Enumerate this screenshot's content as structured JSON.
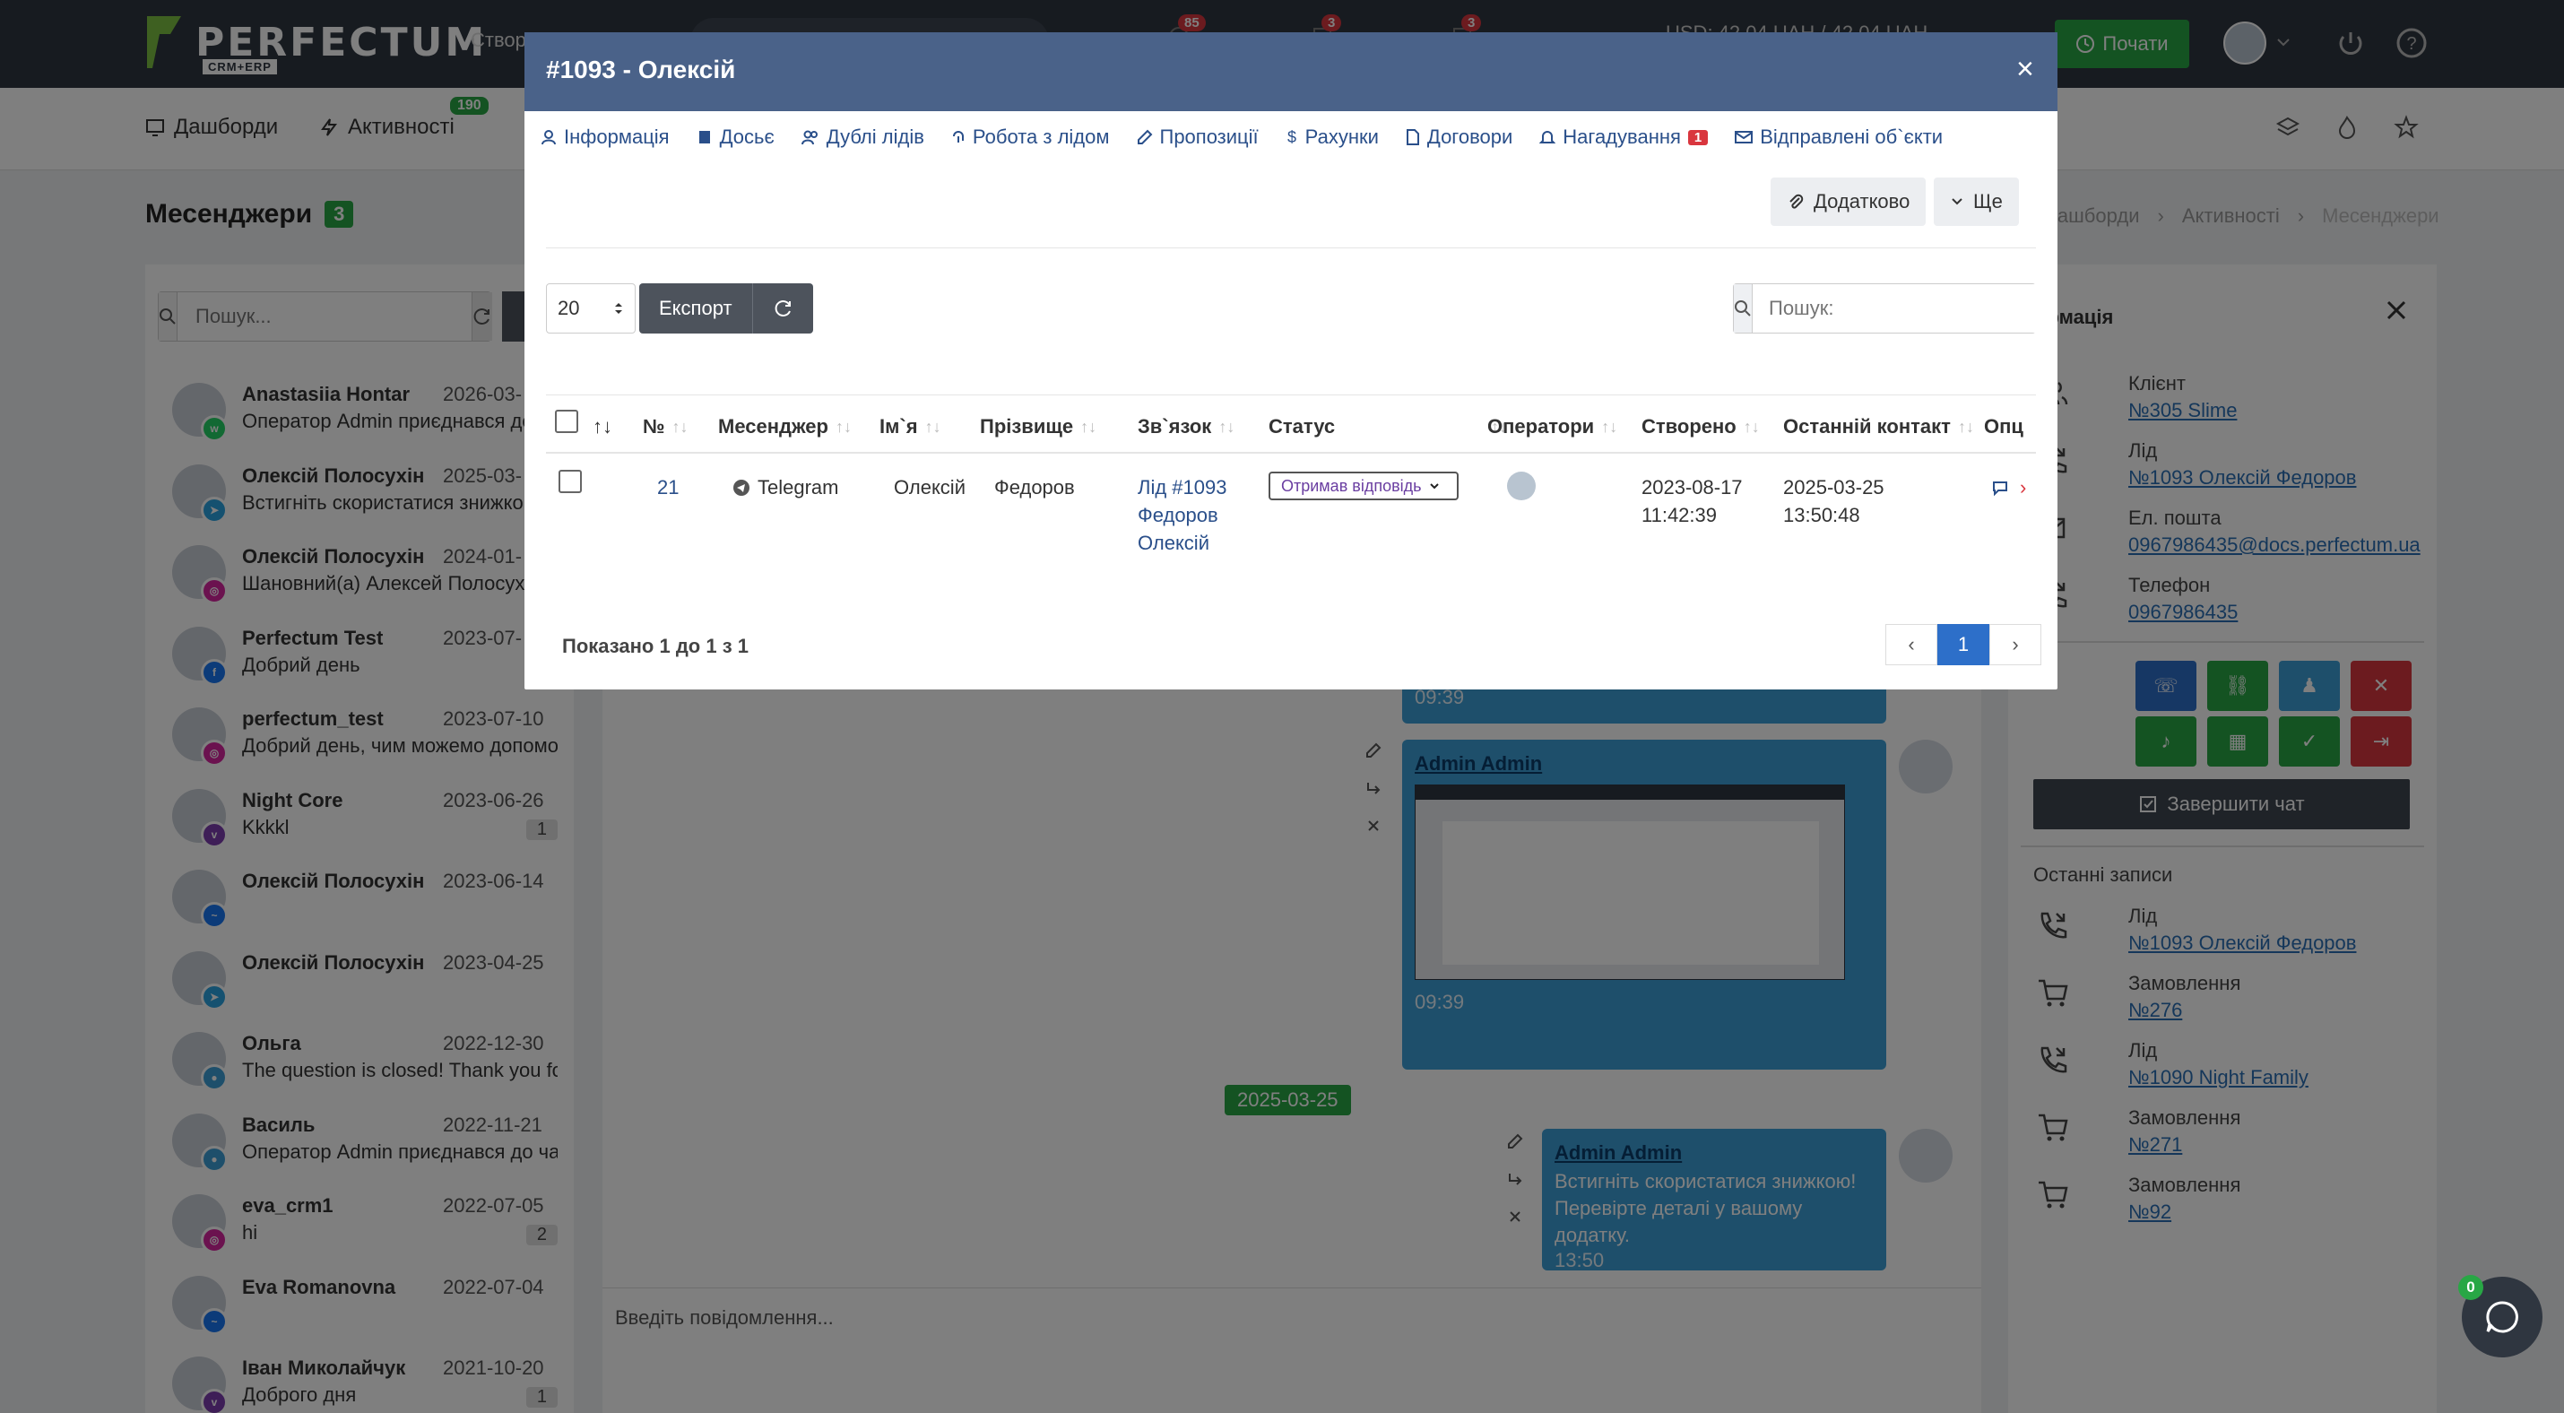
{
  "brand": {
    "name": "PERFECTUM",
    "sub": "CRM+ERP"
  },
  "topbar": {
    "create_label": "Створ",
    "badges": [
      "85",
      "3",
      "3"
    ],
    "rates": "USD: 42.04 UAH / 42.04 UAH",
    "start_button": "Почати"
  },
  "subnav": {
    "items": [
      {
        "label": "Дашборди",
        "icon": "dashboard-icon"
      },
      {
        "label": "Активності",
        "icon": "bolt-icon",
        "badge": "190"
      }
    ]
  },
  "page": {
    "title": "Месенджери",
    "count": "3"
  },
  "breadcrumbs": [
    "Дашборди",
    "Активності",
    "Месенджери"
  ],
  "chatlist": {
    "search_placeholder": "Пошук...",
    "chats": [
      {
        "name": "Anastasiia Hontar",
        "date": "2026-03-",
        "msg": "Оператор Admin приєднався до",
        "net": "whatsapp",
        "count": ""
      },
      {
        "name": "Олексій Полосухін",
        "date": "2025-03-",
        "msg": "Встигніть скористатися знижкою",
        "net": "telegram",
        "count": ""
      },
      {
        "name": "Олексій Полосухін",
        "date": "2024-01-",
        "msg": "Шановний(а) Алексей Полосухин",
        "net": "instagram",
        "count": ""
      },
      {
        "name": "Perfectum Test",
        "date": "2023-07-",
        "msg": "Добрий день",
        "net": "facebook",
        "count": ""
      },
      {
        "name": "perfectum_test",
        "date": "2023-07-10",
        "msg": "Добрий день, чим можемо допомо",
        "net": "instagram",
        "count": ""
      },
      {
        "name": "Night Core",
        "date": "2023-06-26",
        "msg": "Kkkkl",
        "net": "viber",
        "count": "1"
      },
      {
        "name": "Олексій Полосухін",
        "date": "2023-06-14",
        "msg": "",
        "net": "messenger",
        "count": ""
      },
      {
        "name": "Олексій Полосухін",
        "date": "2023-04-25",
        "msg": "",
        "net": "telegram",
        "count": ""
      },
      {
        "name": "Ольга",
        "date": "2022-12-30",
        "msg": "The question is closed! Thank you fo",
        "net": "webchat",
        "count": ""
      },
      {
        "name": "Василь",
        "date": "2022-11-21",
        "msg": "Оператор Admin приєднався до чат",
        "net": "webchat",
        "count": ""
      },
      {
        "name": "eva_crm1",
        "date": "2022-07-05",
        "msg": "hi",
        "net": "instagram",
        "count": "2"
      },
      {
        "name": "Eva Romanovna",
        "date": "2022-07-04",
        "msg": "",
        "net": "messenger",
        "count": ""
      },
      {
        "name": "Іван Миколайчук",
        "date": "2021-10-20",
        "msg": "Доброго дня",
        "net": "viber",
        "count": "1"
      }
    ]
  },
  "chat": {
    "messages": [
      {
        "author": "",
        "text": "",
        "time": "09:39"
      },
      {
        "author": "Admin Admin",
        "text": "",
        "time": "09:39"
      },
      {
        "author": "Admin Admin",
        "text": "Встигніть скористатися знижкою! Перевірте деталі у вашому додатку.",
        "time": "13:50"
      }
    ],
    "date_separator": "2025-03-25",
    "composer_placeholder": "Введіть повідомлення..."
  },
  "info": {
    "header": "ормація",
    "rows": [
      {
        "label": "Клієнт",
        "value": "№305 Slime",
        "icon": "clients-icon"
      },
      {
        "label": "Лід",
        "value": "№1093 Олексій Федоров",
        "icon": "lead-phone-icon"
      },
      {
        "label": "Ел. пошта",
        "value": "0967986435@docs.perfectum.ua",
        "icon": "mail-icon"
      },
      {
        "label": "Телефон",
        "value": "0967986435",
        "icon": "phone-icon"
      }
    ],
    "finish_button": "Завершити чат",
    "recent_title": "Останні записи",
    "recent": [
      {
        "label": "Лід",
        "value": "№1093 Олексій Федоров",
        "icon": "lead-phone-icon"
      },
      {
        "label": "Замовлення",
        "value": "№276",
        "icon": "cart-icon"
      },
      {
        "label": "Лід",
        "value": "№1090 Night Family",
        "icon": "lead-phone-icon"
      },
      {
        "label": "Замовлення",
        "value": "№271",
        "icon": "cart-icon"
      },
      {
        "label": "Замовлення",
        "value": "№92",
        "icon": "cart-icon"
      }
    ],
    "action_colors": [
      "#2d6fc9",
      "#28a745",
      "#3d9fd6",
      "#d9363e",
      "#28a745",
      "#28a745",
      "#28a745",
      "#d9363e"
    ]
  },
  "fab": {
    "badge": "0"
  },
  "modal": {
    "title": "#1093 - Олексій",
    "tabs": [
      {
        "label": "Інформація",
        "icon": "user-icon"
      },
      {
        "label": "Досьє",
        "icon": "book-icon"
      },
      {
        "label": "Дублі лідів",
        "icon": "users-icon"
      },
      {
        "label": "Робота з лідом",
        "icon": "fingerprint-icon"
      },
      {
        "label": "Пропозиції",
        "icon": "pencil-icon"
      },
      {
        "label": "Рахунки",
        "icon": "dollar-icon"
      },
      {
        "label": "Договори",
        "icon": "document-icon"
      },
      {
        "label": "Нагадування",
        "icon": "bell-icon",
        "badge": "1"
      },
      {
        "label": "Відправлені об`єкти",
        "icon": "envelope-icon"
      }
    ],
    "more_button": "Додатково",
    "still_button": "Ще",
    "page_size": "20",
    "export_button": "Експорт",
    "search_placeholder": "Пошук:",
    "columns": [
      "№",
      "Месенджер",
      "Ім`я",
      "Прізвище",
      "Зв`язок",
      "Статус",
      "Оператори",
      "Створено",
      "Останній контакт",
      "Опц"
    ],
    "rows": [
      {
        "num": "21",
        "messenger": "Telegram",
        "first_name": "Олексій",
        "last_name": "Федоров",
        "link_lines": [
          "Лід #1093",
          "Федоров",
          "Олексій"
        ],
        "status": "Отримав відповідь",
        "created": [
          "2023-08-17",
          "11:42:39"
        ],
        "last_contact": [
          "2025-03-25",
          "13:50:48"
        ]
      }
    ],
    "shown_text": "Показано 1 до 1 з 1",
    "pagination": {
      "prev": "‹",
      "current": "1",
      "next": "›"
    }
  }
}
